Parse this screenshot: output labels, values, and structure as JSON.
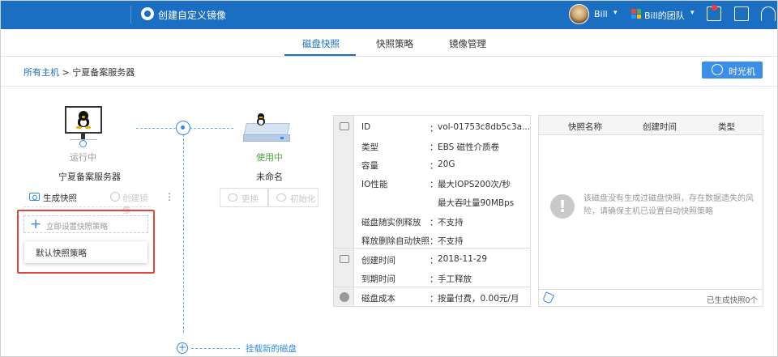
{
  "topbar": {
    "brand_icon": "image-icon",
    "title": "创建自定义镜像",
    "user": "Bill",
    "team": "Bill的团队",
    "icons": [
      "message-icon",
      "checklist-icon",
      "headset-icon"
    ],
    "team_icon_colors": [
      "#f44336",
      "#4caf50",
      "#2196f3",
      "#ffc107"
    ]
  },
  "tabs": [
    {
      "label": "磁盘快照",
      "active": true
    },
    {
      "label": "快照策略",
      "active": false
    },
    {
      "label": "镜像管理",
      "active": false
    }
  ],
  "breadcrumb": {
    "root": "所有主机",
    "separator": ">",
    "current": "宁夏备案服务器"
  },
  "time_machine_button": "时光机",
  "host": {
    "status": "运行中",
    "name": "宁夏备案服务器",
    "actions": {
      "snapshot": "生成快照",
      "image": "创建镜像",
      "more": "⋮"
    },
    "set_policy": {
      "plus": "+",
      "label": "立即设置快照策略"
    },
    "dropdown_item": "默认快照策略"
  },
  "disk": {
    "status": "使用中",
    "name": "未命名",
    "actions": {
      "replace": "更换",
      "init": "初始化"
    },
    "mount_new": "挂载新的磁盘",
    "mount_plus": "+"
  },
  "disk_info": {
    "colon": "：",
    "rows": [
      {
        "key": "ID",
        "value": "vol-01753c8db5c3a..."
      },
      {
        "key": "类型",
        "value": "EBS 磁性介质卷"
      },
      {
        "key": "容量",
        "value": "20G"
      },
      {
        "key": "IO性能",
        "value": "最大IOPS200次/秒"
      },
      {
        "key": "",
        "value": "最大吞吐量90MBps"
      },
      {
        "key": "磁盘随实例释放",
        "value": "不支持"
      },
      {
        "key": "释放删除自动快照",
        "value": "不支持"
      },
      {
        "key": "创建时间",
        "value": "2018-11-29"
      },
      {
        "key": "到期时间",
        "value": "手工释放"
      },
      {
        "key": "磁盘成本",
        "value": "按量付费，0.00元/月"
      }
    ]
  },
  "snapshot_table": {
    "headers": [
      "快照名称",
      "创建时间",
      "类型"
    ],
    "empty_icon": "!",
    "empty_message": "该磁盘没有生成过磁盘快照，存在数据遗失的风险，请确保主机已设置自动快照策略",
    "footer_count": "已生成快照0个"
  }
}
